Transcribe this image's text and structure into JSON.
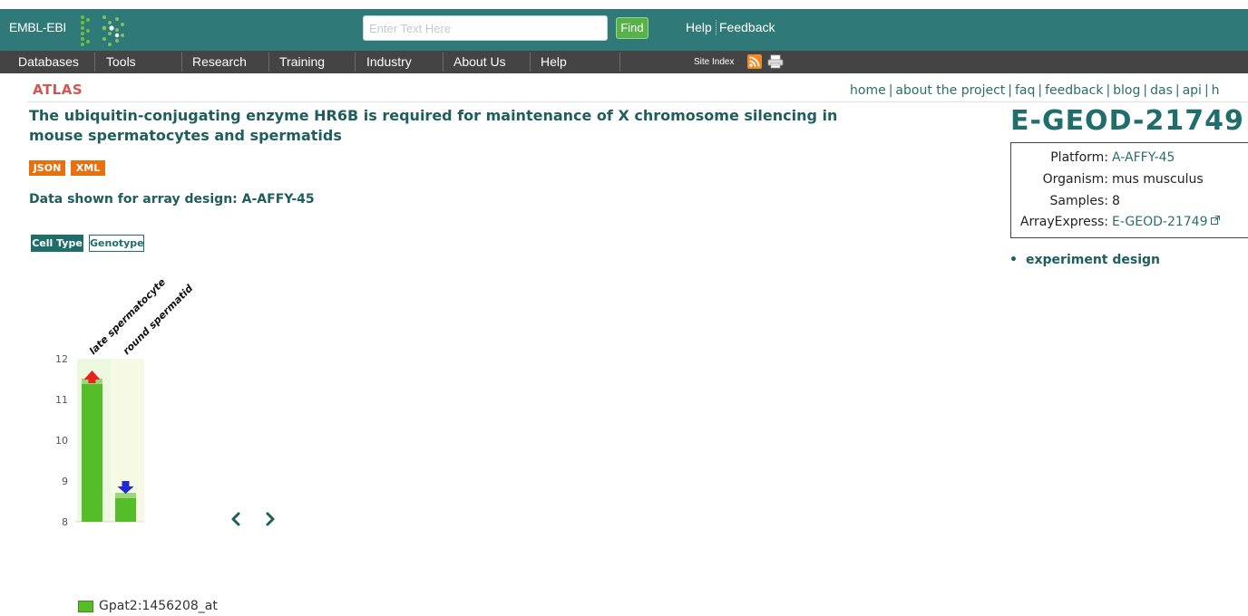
{
  "header": {
    "logo_text": "EMBL-EBI",
    "search_placeholder": "Enter Text Here",
    "find_label": "Find",
    "help_label": "Help",
    "feedback_label": "Feedback"
  },
  "nav": {
    "items": [
      {
        "label": "Databases"
      },
      {
        "label": "Tools"
      },
      {
        "label": "Research"
      },
      {
        "label": "Training"
      },
      {
        "label": "Industry"
      },
      {
        "label": "About Us"
      },
      {
        "label": "Help"
      }
    ],
    "site_index": "Site Index"
  },
  "atlas": {
    "logo": "ATLAS",
    "links": [
      "home",
      "about the project",
      "faq",
      "feedback",
      "blog",
      "das",
      "api",
      "h"
    ]
  },
  "experiment": {
    "title": "The ubiquitin-conjugating enzyme HR6B is required for maintenance of X chromosome silencing in mouse spermatocytes and spermatids",
    "formats": [
      "JSON",
      "XML"
    ],
    "array_prefix": "Data shown for array design: ",
    "array_design": "A-AFFY-45",
    "accession": "E-GEOD-21749"
  },
  "info": {
    "platform_label": "Platform:",
    "platform_value": "A-AFFY-45",
    "organism_label": "Organism:",
    "organism_value": "mus musculus",
    "samples_label": "Samples:",
    "samples_value": "8",
    "arrayexpress_label": "ArrayExpress:",
    "arrayexpress_value": "E-GEOD-21749"
  },
  "design_link": "experiment design",
  "factor_tabs": [
    "Cell Type",
    "Genotype"
  ],
  "colors": {
    "header": "#2f7a78",
    "nav": "#444444",
    "accent": "#1f6e6b",
    "bar": "#55bd2a",
    "up_arrow": "#e8231b",
    "down_arrow": "#1f2ad4"
  },
  "chart_data": {
    "type": "bar",
    "categories": [
      "late spermatocyte",
      "round spermatid"
    ],
    "series": [
      {
        "name": "Gpat2:1456208_at",
        "values": [
          11.4,
          8.6
        ]
      }
    ],
    "direction": [
      "up",
      "down"
    ],
    "ylim": [
      8,
      12
    ],
    "yticks": [
      8,
      9,
      10,
      11,
      12
    ],
    "xlabel": "",
    "ylabel": ""
  }
}
